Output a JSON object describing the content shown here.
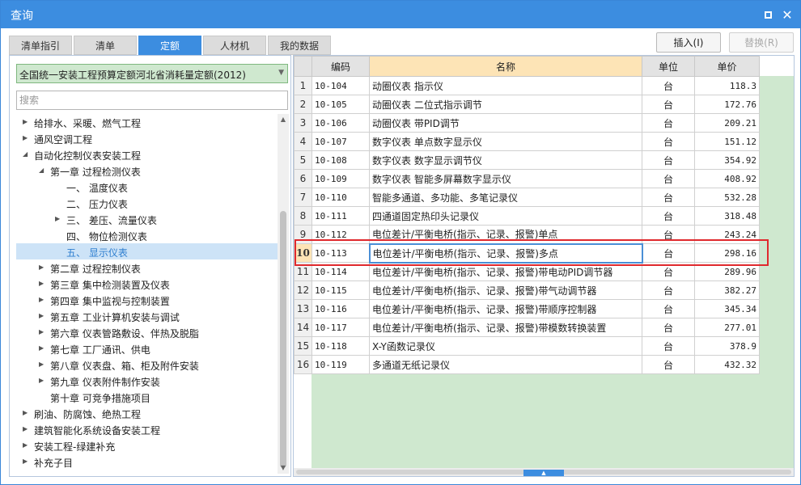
{
  "window": {
    "title": "查询"
  },
  "icons": {
    "maximize": "maximize-icon",
    "close": "close-icon",
    "expand": "triangle-right-icon",
    "collapse": "triangle-down-icon"
  },
  "colors": {
    "accent": "#3c8de0",
    "selection_green": "#cfe8cf",
    "header_highlight": "#fde4b6",
    "highlight_box": "#e0292d"
  },
  "tabs": [
    {
      "label": "清单指引"
    },
    {
      "label": "清单"
    },
    {
      "label": "定额"
    },
    {
      "label": "人材机"
    },
    {
      "label": "我的数据"
    }
  ],
  "active_tab": "定额",
  "toolbar": {
    "insert_label": "插入(I)",
    "replace_label": "替换(R)"
  },
  "left": {
    "dropdown_value": "全国统一安装工程预算定额河北省消耗量定额(2012)",
    "search_placeholder": "搜索",
    "tree": [
      {
        "label": "给排水、采暖、燃气工程",
        "state": "collapsed"
      },
      {
        "label": "通风空调工程",
        "state": "collapsed"
      },
      {
        "label": "自动化控制仪表安装工程",
        "state": "expanded"
      },
      {
        "label": "第一章 过程检测仪表",
        "state": "expanded"
      },
      {
        "label": "一、 温度仪表",
        "state": "leaf"
      },
      {
        "label": "二、 压力仪表",
        "state": "leaf"
      },
      {
        "label": "三、 差压、流量仪表",
        "state": "collapsed"
      },
      {
        "label": "四、 物位检测仪表",
        "state": "leaf"
      },
      {
        "label": "五、 显示仪表",
        "state": "leaf",
        "selected": true
      },
      {
        "label": "第二章 过程控制仪表",
        "state": "collapsed"
      },
      {
        "label": "第三章 集中检测装置及仪表",
        "state": "collapsed"
      },
      {
        "label": "第四章 集中监视与控制装置",
        "state": "collapsed"
      },
      {
        "label": "第五章 工业计算机安装与调试",
        "state": "collapsed"
      },
      {
        "label": "第六章 仪表管路敷设、伴热及脱脂",
        "state": "collapsed"
      },
      {
        "label": "第七章 工厂通讯、供电",
        "state": "collapsed"
      },
      {
        "label": "第八章 仪表盘、箱、柜及附件安装",
        "state": "collapsed"
      },
      {
        "label": "第九章 仪表附件制作安装",
        "state": "collapsed"
      },
      {
        "label": "第十章 可竞争措施项目",
        "state": "leaf"
      },
      {
        "label": "刷油、防腐蚀、绝热工程",
        "state": "collapsed"
      },
      {
        "label": "建筑智能化系统设备安装工程",
        "state": "collapsed"
      },
      {
        "label": "安装工程-绿建补充",
        "state": "collapsed"
      },
      {
        "label": "补充子目",
        "state": "collapsed"
      }
    ]
  },
  "grid": {
    "headers": {
      "code": "编码",
      "name": "名称",
      "unit": "单位",
      "price": "单价"
    },
    "rows": [
      {
        "num": "1",
        "code": "10-104",
        "name": "动圈仪表 指示仪",
        "unit": "台",
        "price": "118.3"
      },
      {
        "num": "2",
        "code": "10-105",
        "name": "动圈仪表 二位式指示调节",
        "unit": "台",
        "price": "172.76"
      },
      {
        "num": "3",
        "code": "10-106",
        "name": "动圈仪表 带PID调节",
        "unit": "台",
        "price": "209.21"
      },
      {
        "num": "4",
        "code": "10-107",
        "name": "数字仪表 单点数字显示仪",
        "unit": "台",
        "price": "151.12"
      },
      {
        "num": "5",
        "code": "10-108",
        "name": "数字仪表 数字显示调节仪",
        "unit": "台",
        "price": "354.92"
      },
      {
        "num": "6",
        "code": "10-109",
        "name": "数字仪表 智能多屏幕数字显示仪",
        "unit": "台",
        "price": "408.92"
      },
      {
        "num": "7",
        "code": "10-110",
        "name": "智能多通道、多功能、多笔记录仪",
        "unit": "台",
        "price": "532.28"
      },
      {
        "num": "8",
        "code": "10-111",
        "name": "四通道固定热印头记录仪",
        "unit": "台",
        "price": "318.48"
      },
      {
        "num": "9",
        "code": "10-112",
        "name": "电位差计/平衡电桥(指示、记录、报警)单点",
        "unit": "台",
        "price": "243.24"
      },
      {
        "num": "10",
        "code": "10-113",
        "name": "电位差计/平衡电桥(指示、记录、报警)多点",
        "unit": "台",
        "price": "298.16",
        "current": true
      },
      {
        "num": "11",
        "code": "10-114",
        "name": "电位差计/平衡电桥(指示、记录、报警)带电动PID调节器",
        "unit": "台",
        "price": "289.96"
      },
      {
        "num": "12",
        "code": "10-115",
        "name": "电位差计/平衡电桥(指示、记录、报警)带气动调节器",
        "unit": "台",
        "price": "382.27"
      },
      {
        "num": "13",
        "code": "10-116",
        "name": "电位差计/平衡电桥(指示、记录、报警)带顺序控制器",
        "unit": "台",
        "price": "345.34"
      },
      {
        "num": "14",
        "code": "10-117",
        "name": "电位差计/平衡电桥(指示、记录、报警)带模数转换装置",
        "unit": "台",
        "price": "277.01"
      },
      {
        "num": "15",
        "code": "10-118",
        "name": "X-Y函数记录仪",
        "unit": "台",
        "price": "378.9"
      },
      {
        "num": "16",
        "code": "10-119",
        "name": "多通道无纸记录仪",
        "unit": "台",
        "price": "432.32"
      }
    ]
  }
}
